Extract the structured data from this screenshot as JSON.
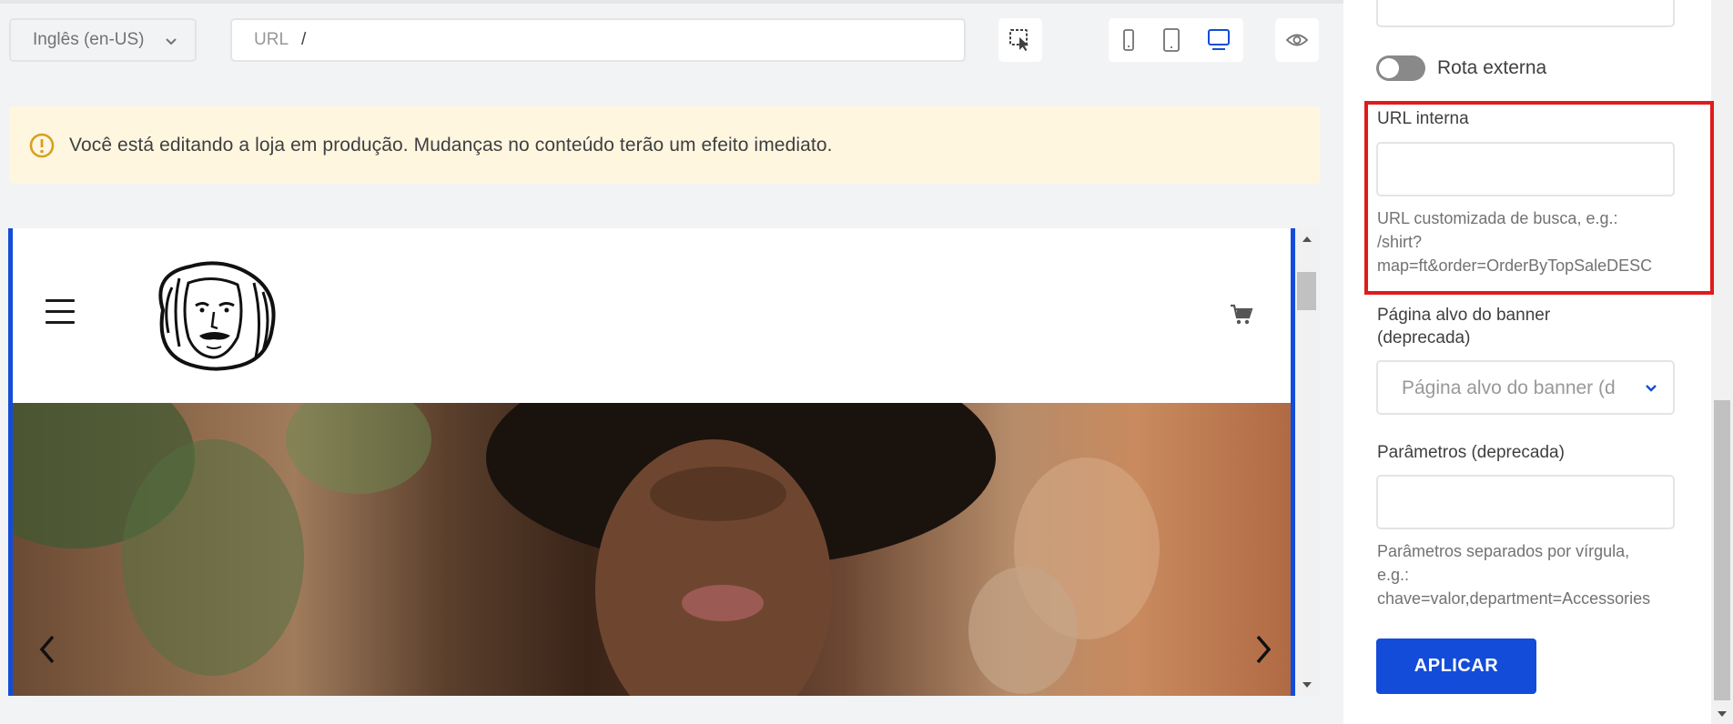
{
  "toolbar": {
    "locale": "Inglês (en-US)",
    "url_label": "URL",
    "url_value": "/"
  },
  "warning": {
    "text": "Você está editando a loja em produção. Mudanças no conteúdo terão um efeito imediato."
  },
  "sidebar": {
    "external_route_label": "Rota externa",
    "internal_url_label": "URL interna",
    "internal_url_value": "",
    "internal_url_help_1": "URL customizada de busca, e.g.:",
    "internal_url_help_2": "/shirt?",
    "internal_url_help_3": "map=ft&order=OrderByTopSaleDESC",
    "banner_target_label_1": "Página alvo do banner",
    "banner_target_label_2": "(deprecada)",
    "banner_target_placeholder": "Página alvo do banner (d",
    "params_label": "Parâmetros (deprecada)",
    "params_value": "",
    "params_help_1": "Parâmetros separados por vírgula,",
    "params_help_2": "e.g.:",
    "params_help_3": "chave=valor,department=Accessories",
    "apply_label": "APLICAR"
  },
  "colors": {
    "accent": "#134cd8",
    "warning_bg": "#fff6e0",
    "warning_icon": "#d6a01e",
    "highlight": "#e01b1b"
  },
  "icons": [
    "chevron-down-icon",
    "element-picker-icon",
    "mobile-icon",
    "tablet-icon",
    "desktop-icon",
    "eye-icon",
    "warning-icon",
    "hamburger-icon",
    "cart-icon",
    "arrow-left-icon",
    "arrow-right-icon"
  ]
}
